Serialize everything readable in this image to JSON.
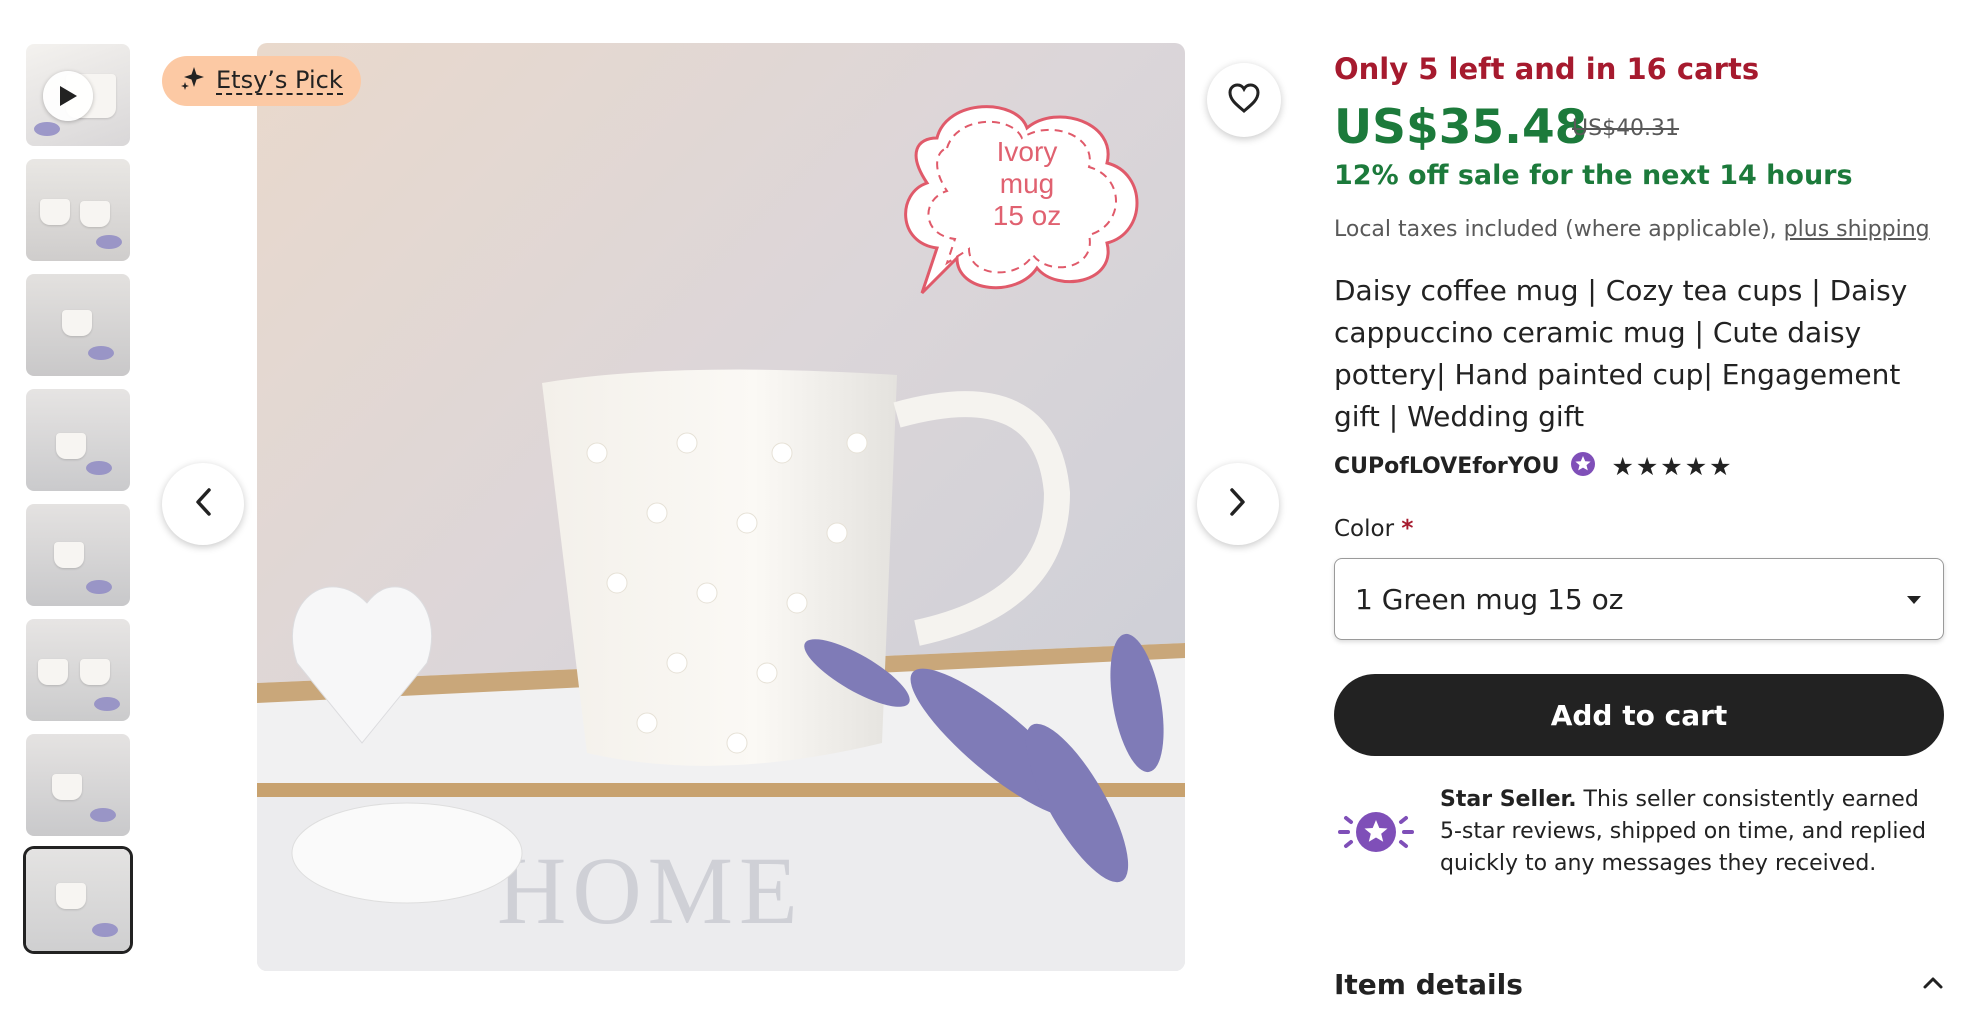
{
  "gallery": {
    "badge_label": "Etsy’s Pick",
    "image_overlay_text": [
      "Ivory",
      "mug",
      "15 oz"
    ],
    "thumbnail_count": 8,
    "active_thumbnail": 8
  },
  "listing": {
    "stock_text": "Only 5 left and in 16 carts",
    "price": "US$35.48",
    "original_price": "US$40.31",
    "sale_text": "12% off sale for the next 14 hours",
    "tax_text": "Local taxes included (where applicable),",
    "shipping_link": "plus shipping",
    "title": "Daisy coffee mug | Cozy tea cups | Daisy cappuccino ceramic mug | Cute daisy pottery| Hand painted cup| Engagement gift | Wedding gift",
    "seller_name": "CUPofLOVEforYOU",
    "rating_stars": "★★★★★",
    "rating_value": 5
  },
  "options": {
    "color_label": "Color",
    "required_mark": "*",
    "selected_color": "1 Green mug 15 oz"
  },
  "actions": {
    "add_to_cart": "Add to cart"
  },
  "star_seller": {
    "title": "Star Seller.",
    "description": " This seller consistently earned 5-star reviews, shipped on time, and replied quickly to any messages they received."
  },
  "sections": {
    "item_details": "Item details"
  },
  "colors": {
    "price_green": "#1c7a3b",
    "stock_red": "#a61a2e",
    "badge_peach": "#fcc9a4",
    "star_seller_purple": "#7f4fb8",
    "button_dark": "#222222"
  }
}
